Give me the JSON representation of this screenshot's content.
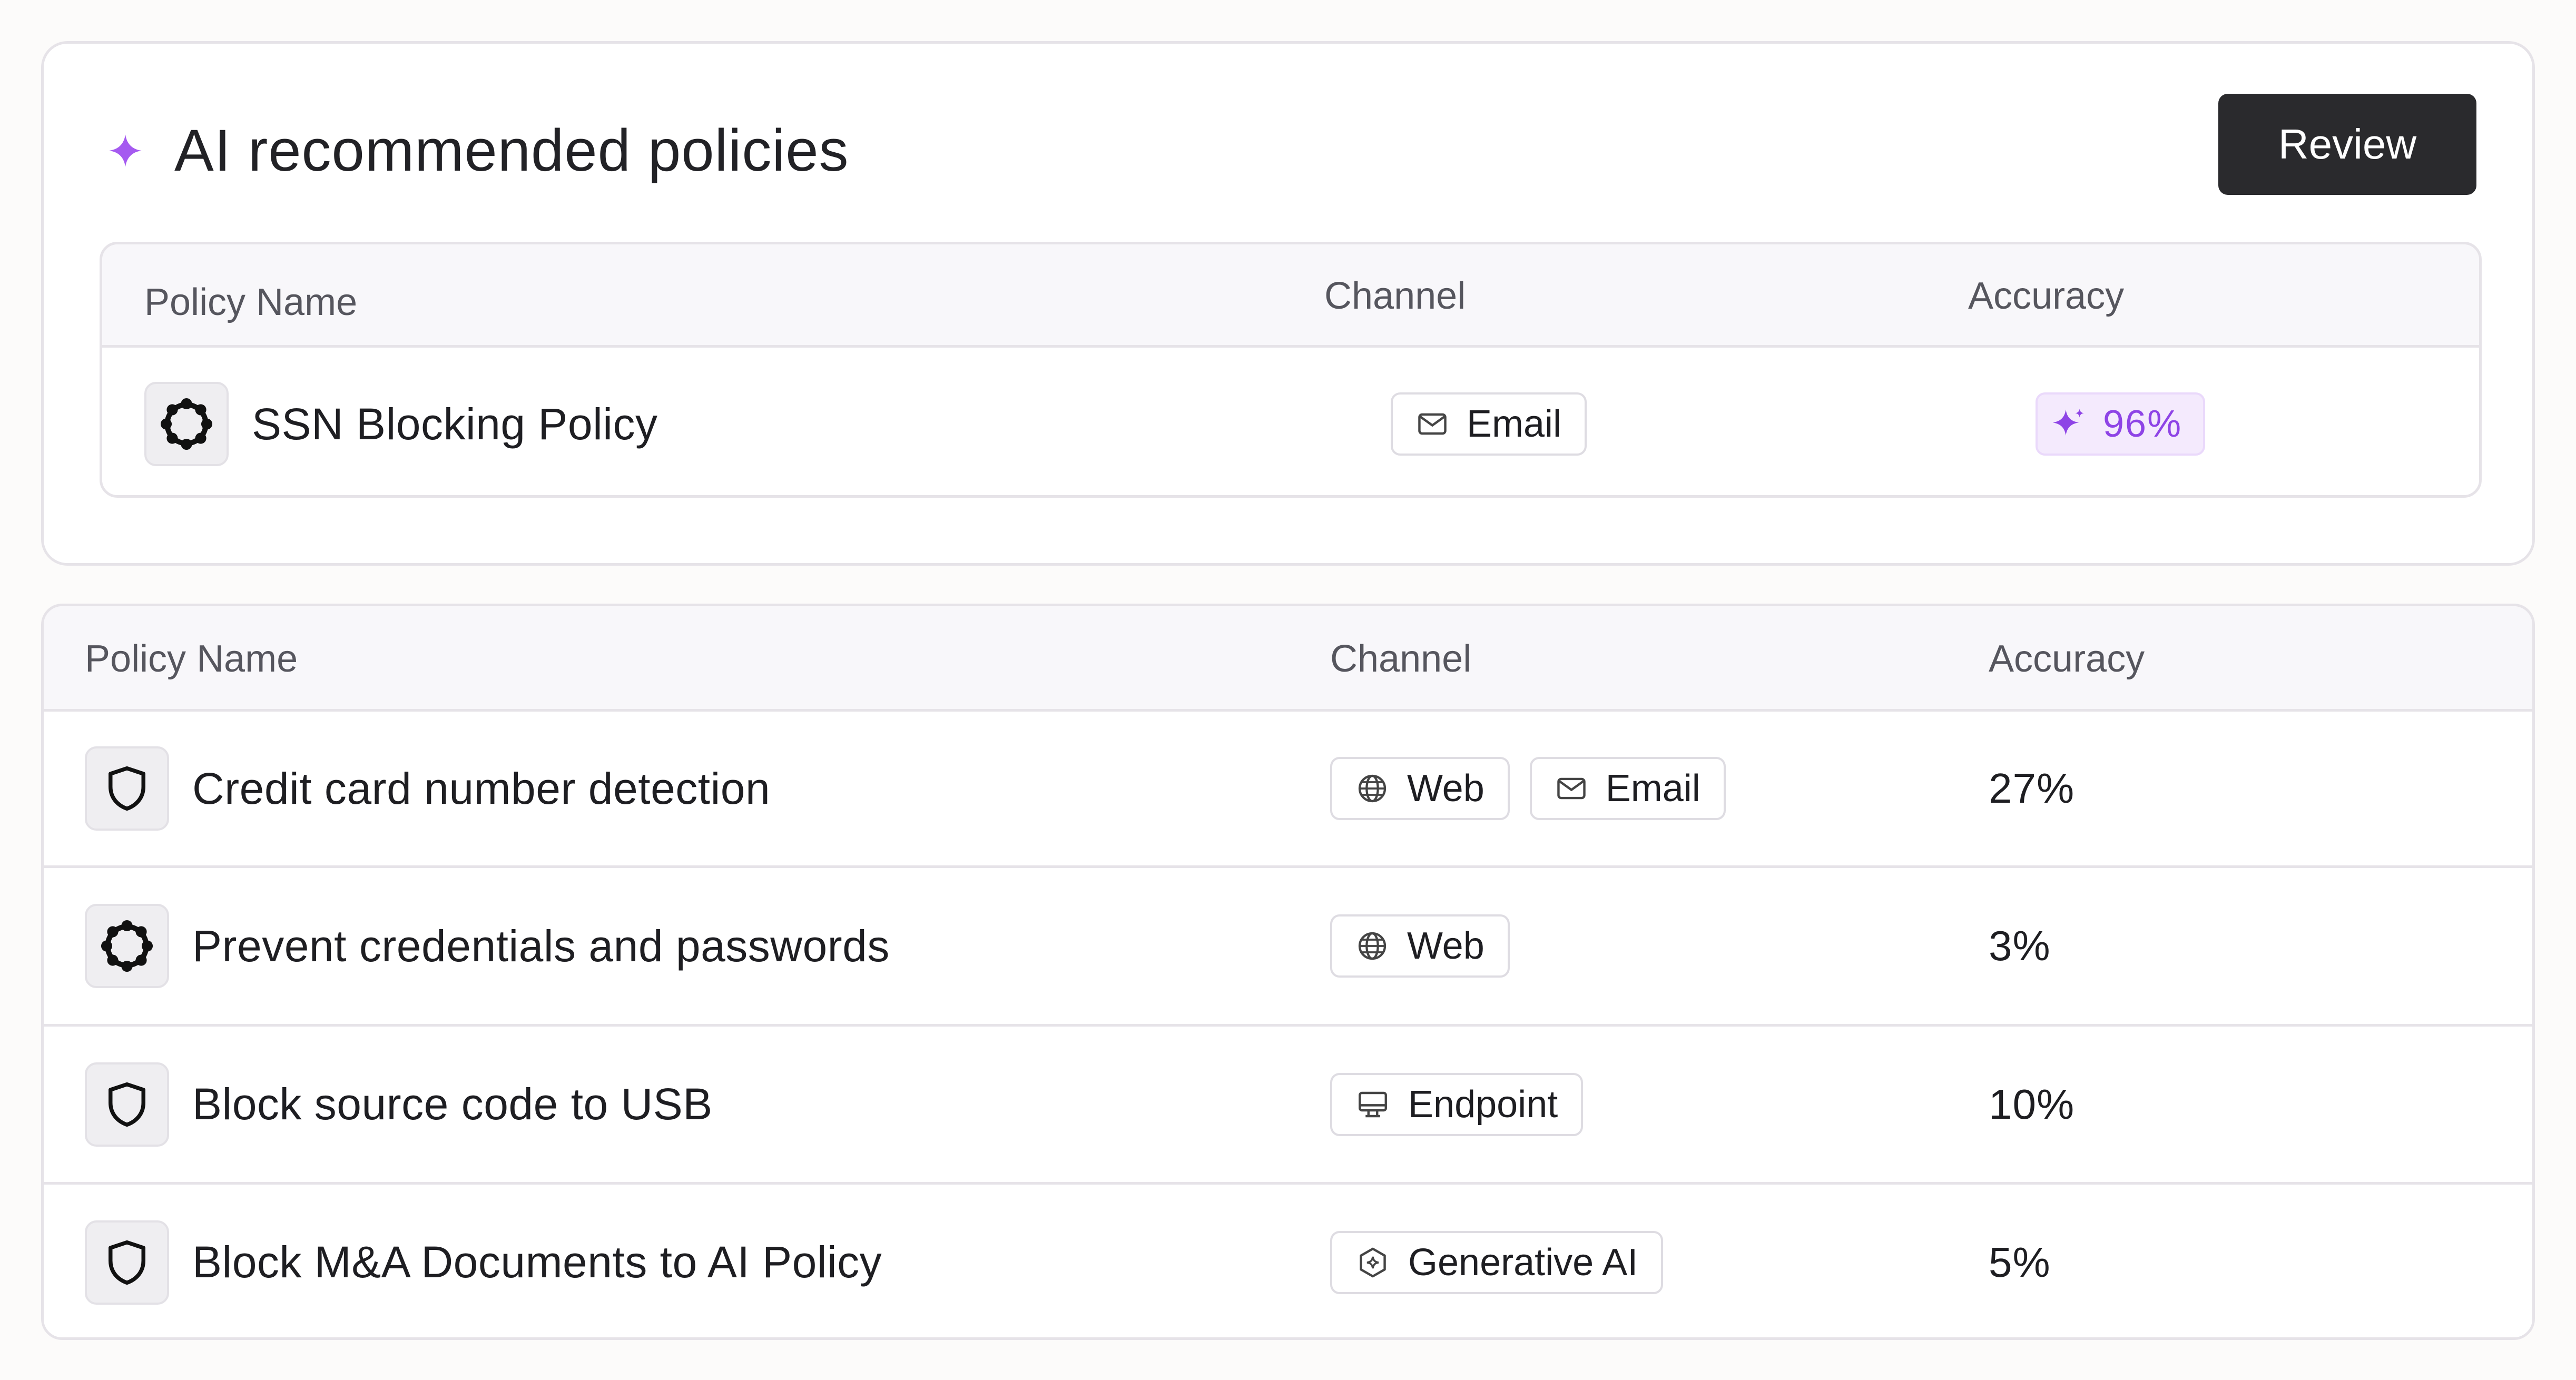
{
  "recommended": {
    "title": "AI recommended policies",
    "review_label": "Review",
    "columns": {
      "name": "Policy Name",
      "channel": "Channel",
      "accuracy": "Accuracy"
    },
    "row": {
      "name": "SSN Blocking Policy",
      "icon": "ring-dots-icon",
      "channels": [
        {
          "label": "Email",
          "icon": "mail-icon"
        }
      ],
      "accuracy": "96%"
    }
  },
  "policies": {
    "columns": {
      "name": "Policy Name",
      "channel": "Channel",
      "accuracy": "Accuracy"
    },
    "rows": [
      {
        "name": "Credit card number detection",
        "icon": "shield-icon",
        "channels": [
          {
            "label": "Web",
            "icon": "globe-icon"
          },
          {
            "label": "Email",
            "icon": "mail-icon"
          }
        ],
        "accuracy": "27%"
      },
      {
        "name": "Prevent credentials and passwords",
        "icon": "ring-dots-icon",
        "channels": [
          {
            "label": "Web",
            "icon": "globe-icon"
          }
        ],
        "accuracy": "3%"
      },
      {
        "name": "Block source code to USB",
        "icon": "shield-icon",
        "channels": [
          {
            "label": "Endpoint",
            "icon": "monitor-icon"
          }
        ],
        "accuracy": "10%"
      },
      {
        "name": "Block M&A Documents to AI Policy",
        "icon": "shield-icon",
        "channels": [
          {
            "label": "Generative AI",
            "icon": "ai-hexagon-icon"
          }
        ],
        "accuracy": "5%"
      }
    ]
  },
  "colors": {
    "accent_purple": "#8e44e6",
    "accent_badge_bg": "#f4eafd",
    "button_dark": "#2a2a2d",
    "border": "#e6e3e8",
    "header_bg": "#f8f7fa"
  }
}
